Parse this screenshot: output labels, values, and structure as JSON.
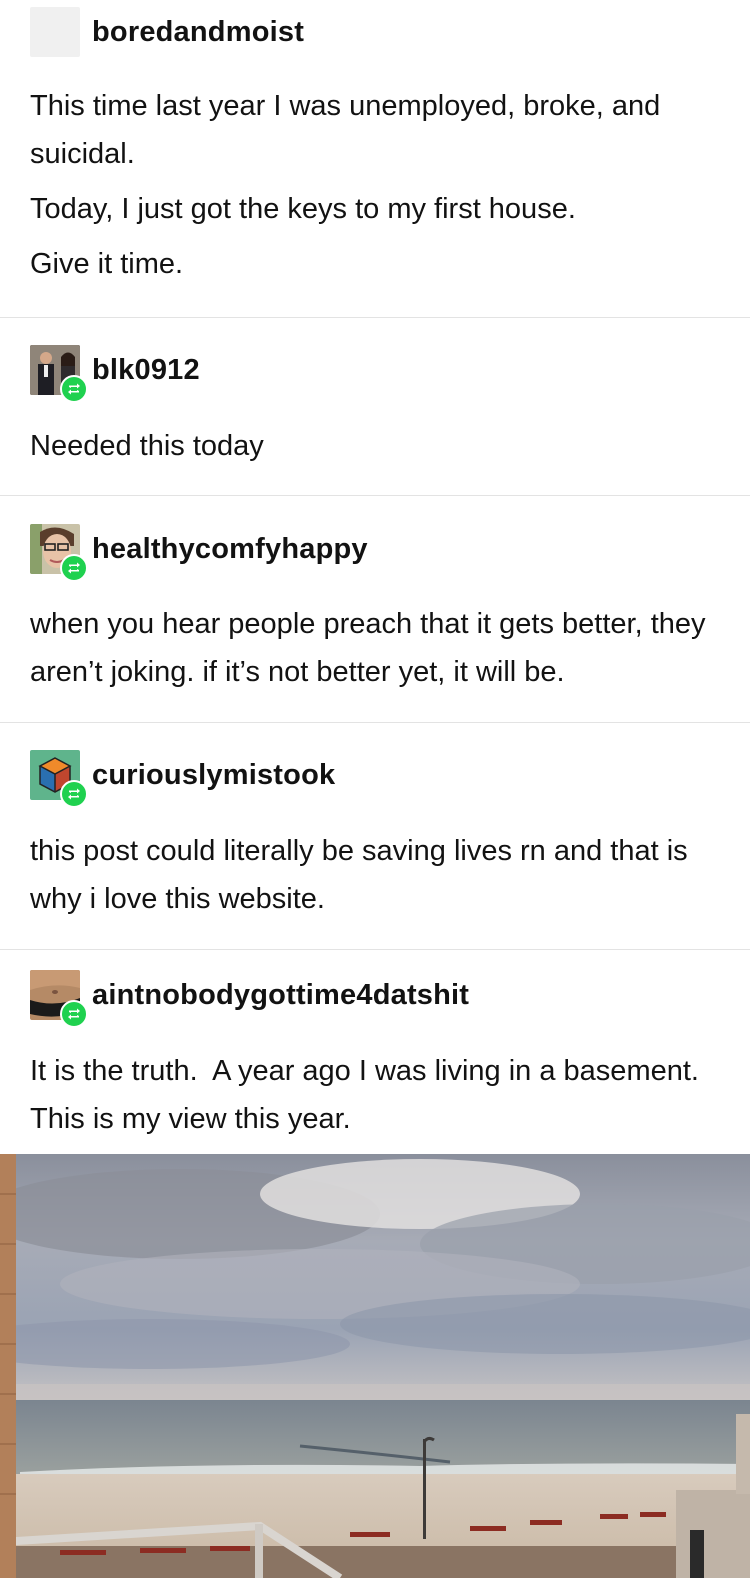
{
  "posts": [
    {
      "username": "boredandmoist",
      "avatar_icon": "blank-avatar",
      "reblog": false,
      "paragraphs": [
        "This time last year I was unemployed, broke, and suicidal.",
        "Today, I just got the keys to my first house.",
        "Give it time."
      ]
    },
    {
      "username": "blk0912",
      "avatar_icon": "couple-photo-avatar",
      "reblog": true,
      "paragraphs": [
        "Needed this today"
      ]
    },
    {
      "username": "healthycomfyhappy",
      "avatar_icon": "selfie-glasses-avatar",
      "reblog": true,
      "paragraphs": [
        "when you hear people preach that it gets better, they aren’t joking. if it’s not better yet, it will be."
      ]
    },
    {
      "username": "curiouslymistook",
      "avatar_icon": "cube-avatar",
      "reblog": true,
      "paragraphs": [
        "this post could literally be saving lives rn and that is why i love this website."
      ]
    },
    {
      "username": "aintnobodygottime4datshit",
      "avatar_icon": "torso-photo-avatar",
      "reblog": true,
      "paragraphs": [
        "It is the truth.  A year ago I was living in a basement.  This is my view this year."
      ]
    }
  ],
  "photo": {
    "description_icon": "beach-view-photo"
  },
  "colors": {
    "reblog_green": "#1fd14f",
    "divider": "#e3e3e3",
    "text": "#121212"
  }
}
